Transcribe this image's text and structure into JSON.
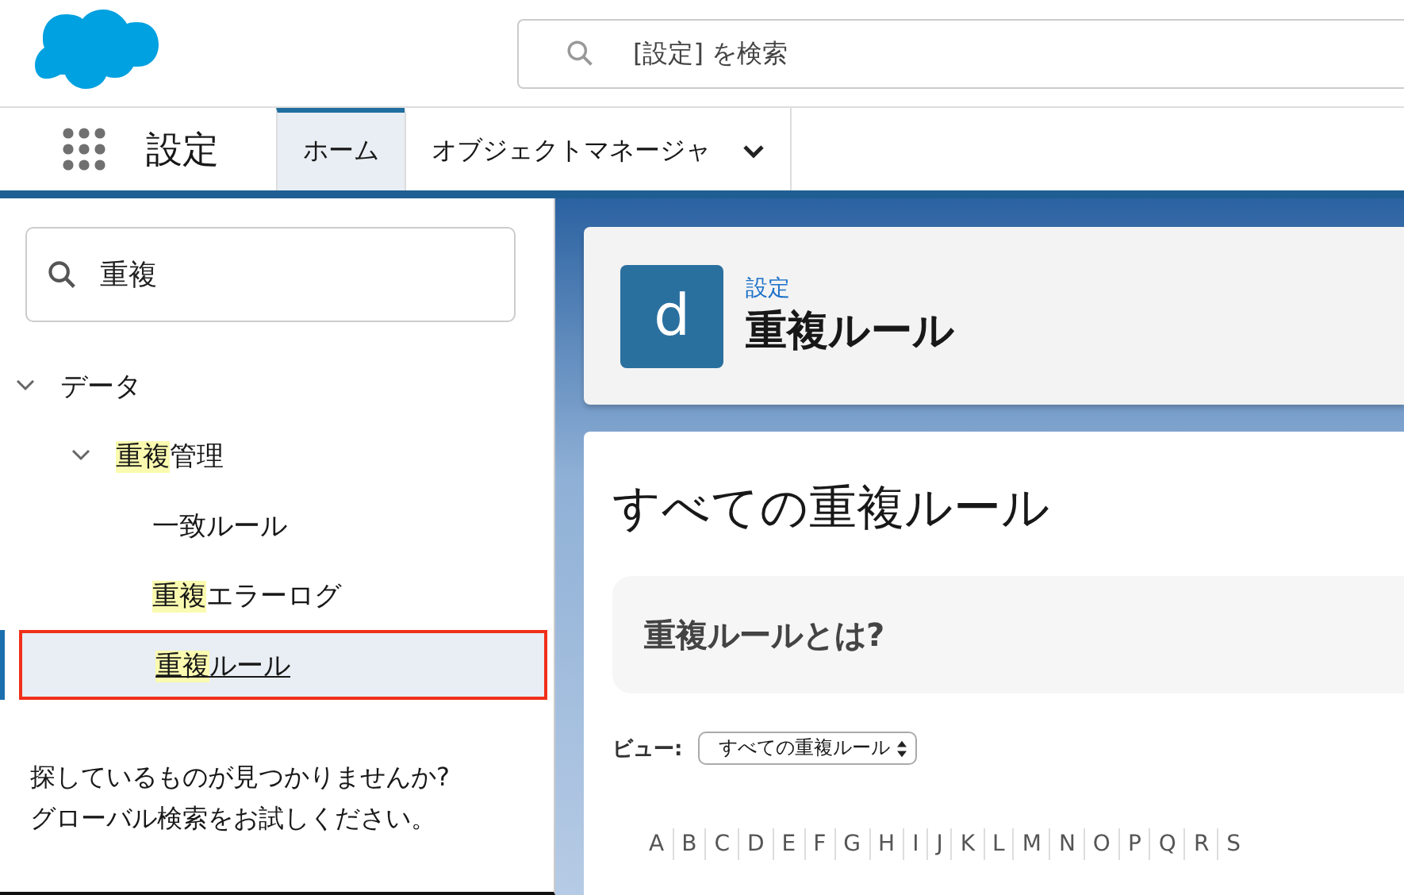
{
  "header": {
    "search": {
      "placeholder": "[設定] を検索"
    }
  },
  "nav": {
    "app_title": "設定",
    "tabs": [
      {
        "label": "ホーム",
        "selected": true,
        "has_menu": false
      },
      {
        "label": "オブジェクトマネージャ",
        "selected": false,
        "has_menu": true
      }
    ]
  },
  "sidebar": {
    "search": {
      "value": "重複"
    },
    "tree": [
      {
        "parts": [
          {
            "text": "データ",
            "highlighted": false
          }
        ],
        "expanded": true,
        "selected": false,
        "outlined": false,
        "children": [
          {
            "parts": [
              {
                "text": "重複",
                "highlighted": true
              },
              {
                "text": "管理",
                "highlighted": false
              }
            ],
            "expanded": true,
            "selected": false,
            "outlined": false,
            "children": [
              {
                "parts": [
                  {
                    "text": "一致ルール",
                    "highlighted": false
                  }
                ],
                "selected": false,
                "outlined": false
              },
              {
                "parts": [
                  {
                    "text": "重複",
                    "highlighted": true
                  },
                  {
                    "text": "エラーログ",
                    "highlighted": false
                  }
                ],
                "selected": false,
                "outlined": false
              },
              {
                "parts": [
                  {
                    "text": "重複",
                    "highlighted": true
                  },
                  {
                    "text": "ルール",
                    "highlighted": false
                  }
                ],
                "selected": true,
                "outlined": true
              }
            ]
          }
        ]
      }
    ],
    "help_text": "探しているものが見つかりませんか?\nグローバル検索をお試しください。"
  },
  "main": {
    "page_header": {
      "icon_letter": "d",
      "breadcrumb": "設定",
      "title": "重複ルール"
    },
    "page_title": "すべての重複ルール",
    "info_heading": "重複ルールとは?",
    "view": {
      "label": "ビュー:",
      "value": "すべての重複ルール"
    },
    "letters": [
      "A",
      "B",
      "C",
      "D",
      "E",
      "F",
      "G",
      "H",
      "I",
      "J",
      "K",
      "L",
      "M",
      "N",
      "O",
      "P",
      "Q",
      "R",
      "S"
    ]
  }
}
